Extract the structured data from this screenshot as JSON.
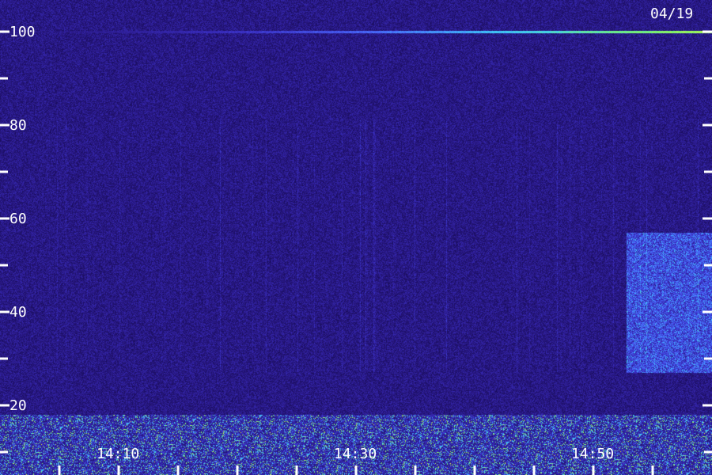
{
  "chart_data": {
    "type": "heatmap",
    "title": "",
    "date_label": "04/19",
    "xlabel": "",
    "ylabel": "",
    "x_axis": {
      "unit": "minutes",
      "range": [
        14.033,
        15.0
      ],
      "tick_labels": [
        "14:10",
        "14:30",
        "14:50"
      ],
      "tick_values_labeled": [
        14.1667,
        14.5,
        14.8333
      ],
      "minor_tick_spacing_minutes": 5
    },
    "y_axis": {
      "range": [
        0,
        105
      ],
      "tick_labels": [
        "100",
        "80",
        "60",
        "40",
        "20"
      ],
      "tick_values_labeled": [
        100,
        80,
        60,
        40,
        20
      ],
      "minor_tick_values": [
        90,
        70,
        50,
        30,
        10
      ]
    },
    "colormap": [
      "#1a0d5e",
      "#2b1a8a",
      "#3a2fc4",
      "#4a6aff",
      "#3fd6ff",
      "#7dff6a",
      "#f0ff3a"
    ],
    "features": [
      {
        "name": "steady line",
        "y": 100,
        "x_range": [
          14.033,
          15.0
        ],
        "intensity": 0.85
      },
      {
        "name": "broadband region",
        "y_range": [
          27,
          57
        ],
        "x_range": [
          14.88,
          15.0
        ],
        "intensity": 0.55
      },
      {
        "name": "low band",
        "y_range": [
          0,
          18
        ],
        "x_range": [
          14.033,
          15.0
        ],
        "intensity": 0.75
      }
    ]
  }
}
